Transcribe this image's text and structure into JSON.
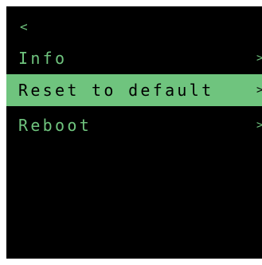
{
  "header": {
    "back_label": "<"
  },
  "menu": {
    "items": [
      {
        "label": "Info",
        "chevron": ">",
        "selected": false
      },
      {
        "label": "Reset to default",
        "chevron": ">",
        "selected": true
      },
      {
        "label": "Reboot",
        "chevron": ">",
        "selected": false
      }
    ]
  },
  "colors": {
    "background": "#000000",
    "accent": "#6fc47e",
    "selected_text": "#000000"
  }
}
